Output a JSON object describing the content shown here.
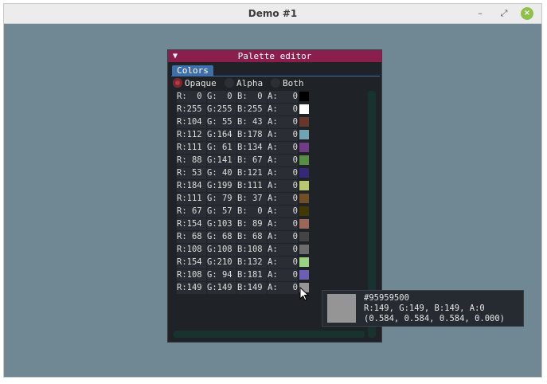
{
  "window": {
    "title": "Demo #1",
    "minimize": "–",
    "maximize": "⤢",
    "close": "×"
  },
  "palette_editor": {
    "title": "Palette editor",
    "collapse_arrow": "▼",
    "tab": "Colors",
    "radios": [
      {
        "label": "Opaque",
        "selected": true
      },
      {
        "label": "Alpha",
        "selected": false
      },
      {
        "label": "Both",
        "selected": false
      }
    ],
    "rows": [
      {
        "r": "R:  0",
        "g": "G:  0",
        "b": "B:  0",
        "a": "A:   0",
        "color": "#000000"
      },
      {
        "r": "R:255",
        "g": "G:255",
        "b": "B:255",
        "a": "A:   0",
        "color": "#ffffff"
      },
      {
        "r": "R:104",
        "g": "G: 55",
        "b": "B: 43",
        "a": "A:   0",
        "color": "#68372b"
      },
      {
        "r": "R:112",
        "g": "G:164",
        "b": "B:178",
        "a": "A:   0",
        "color": "#70a4b2"
      },
      {
        "r": "R:111",
        "g": "G: 61",
        "b": "B:134",
        "a": "A:   0",
        "color": "#6f3d86"
      },
      {
        "r": "R: 88",
        "g": "G:141",
        "b": "B: 67",
        "a": "A:   0",
        "color": "#588d43"
      },
      {
        "r": "R: 53",
        "g": "G: 40",
        "b": "B:121",
        "a": "A:   0",
        "color": "#352879"
      },
      {
        "r": "R:184",
        "g": "G:199",
        "b": "B:111",
        "a": "A:   0",
        "color": "#b8c76f"
      },
      {
        "r": "R:111",
        "g": "G: 79",
        "b": "B: 37",
        "a": "A:   0",
        "color": "#6f4f25"
      },
      {
        "r": "R: 67",
        "g": "G: 57",
        "b": "B:  0",
        "a": "A:   0",
        "color": "#433900"
      },
      {
        "r": "R:154",
        "g": "G:103",
        "b": "B: 89",
        "a": "A:   0",
        "color": "#9a6759"
      },
      {
        "r": "R: 68",
        "g": "G: 68",
        "b": "B: 68",
        "a": "A:   0",
        "color": "#444444"
      },
      {
        "r": "R:108",
        "g": "G:108",
        "b": "B:108",
        "a": "A:   0",
        "color": "#6c6c6c"
      },
      {
        "r": "R:154",
        "g": "G:210",
        "b": "B:132",
        "a": "A:   0",
        "color": "#9ad284"
      },
      {
        "r": "R:108",
        "g": "G: 94",
        "b": "B:181",
        "a": "A:   0",
        "color": "#6c5eb5"
      },
      {
        "r": "R:149",
        "g": "G:149",
        "b": "B:149",
        "a": "A:   0",
        "color": "#959595"
      }
    ]
  },
  "tooltip": {
    "hex": "#95959500",
    "rgba": "R:149, G:149, B:149, A:0",
    "float": "(0.584, 0.584, 0.584, 0.000)",
    "color": "#959595"
  },
  "colors": {
    "desktop": "#6f8894",
    "title_accent": "#8a1f4e",
    "tab_accent": "#3f6fa8",
    "radio_selected": "#b23a45"
  }
}
